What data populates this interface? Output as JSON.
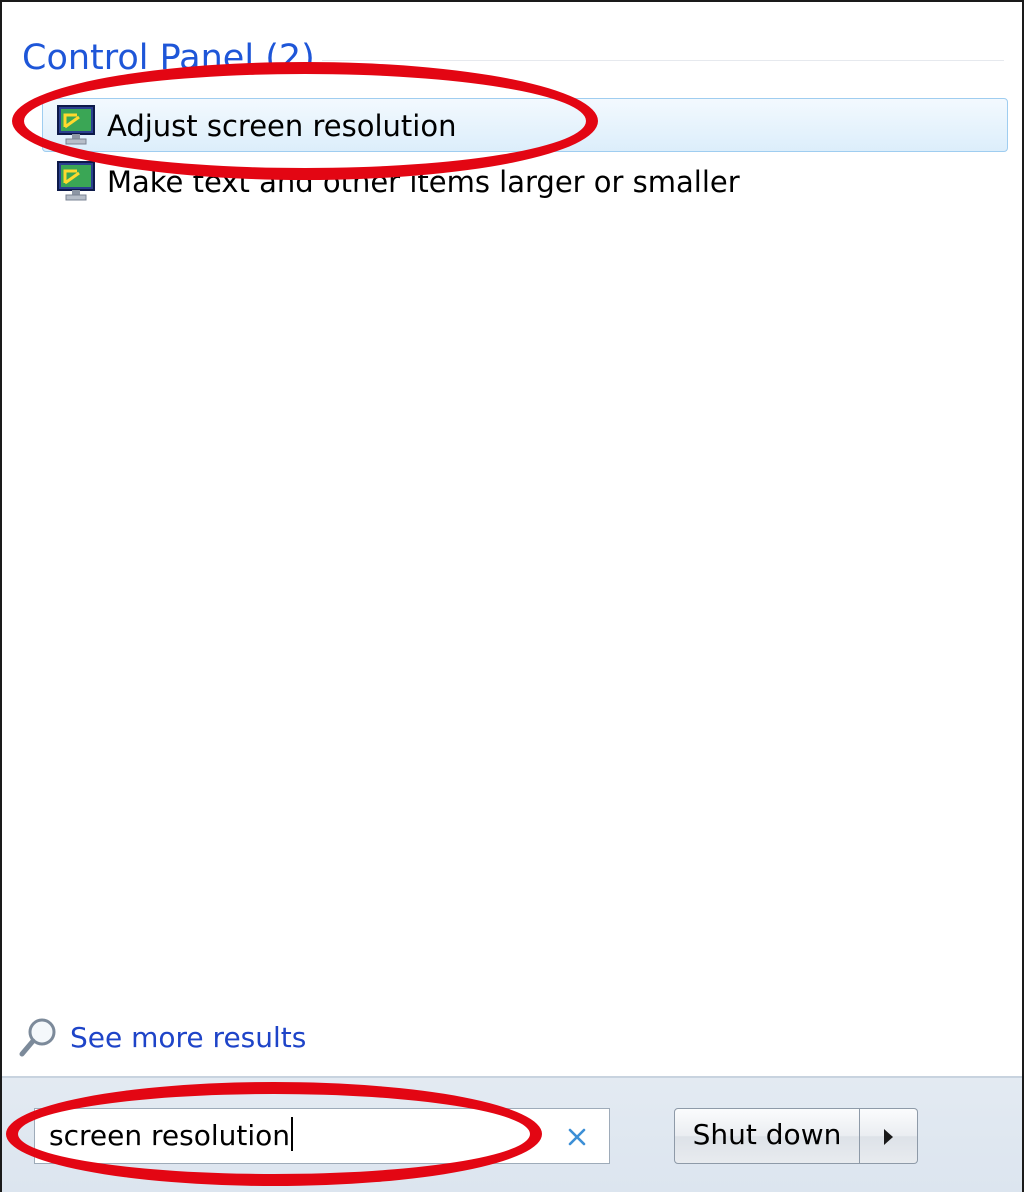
{
  "results": {
    "section_title": "Control Panel (2)",
    "items": [
      {
        "label": "Adjust screen resolution",
        "icon": "display-settings-icon",
        "selected": true
      },
      {
        "label": "Make text and other items larger or smaller",
        "icon": "display-settings-icon",
        "selected": false
      }
    ],
    "see_more": {
      "label": "See more results",
      "icon": "magnifier-icon"
    }
  },
  "search": {
    "value": "screen resolution",
    "clear_icon": "close-icon"
  },
  "power": {
    "shutdown_label": "Shut down",
    "arrow_icon": "play-arrow-icon"
  },
  "annotations": {
    "color": "#e30613",
    "targets": [
      "adjust-screen-resolution-item",
      "search-input"
    ]
  },
  "colors": {
    "section_title": "#1e56d8",
    "link": "#1e44c8",
    "selection_border": "#9fcdf0",
    "bottom_bar": "#dce5ef"
  }
}
